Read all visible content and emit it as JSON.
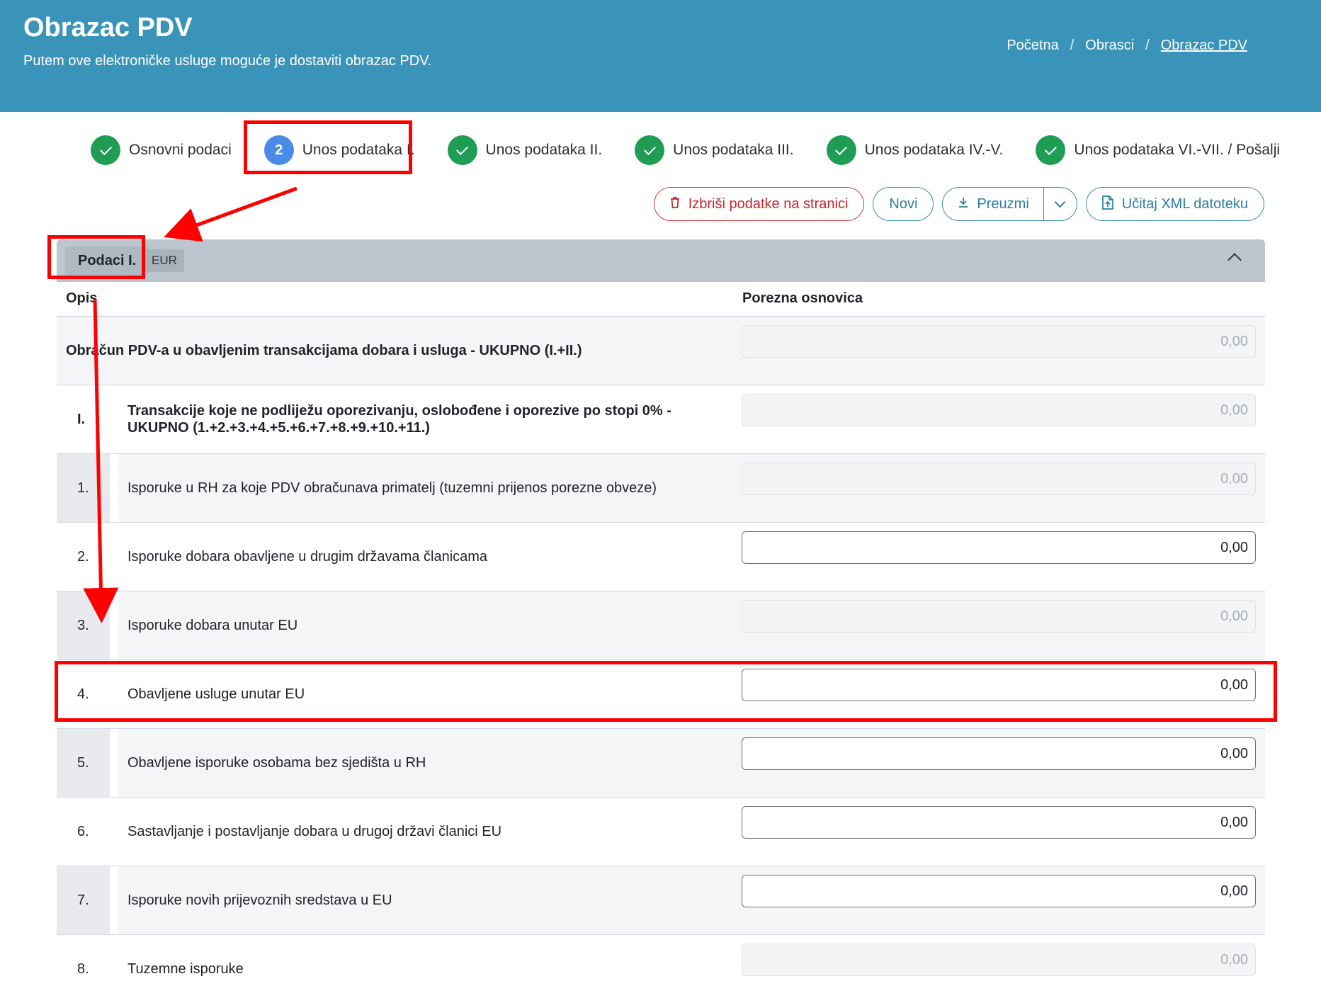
{
  "header": {
    "title": "Obrazac PDV",
    "subtitle": "Putem ove elektroničke usluge moguće je dostaviti obrazac PDV.",
    "breadcrumb": [
      "Početna",
      "Obrasci",
      "Obrazac PDV"
    ],
    "separator": "/"
  },
  "steps": [
    {
      "label": "Osnovni podaci",
      "state": "done"
    },
    {
      "label": "Unos podataka I.",
      "state": "active",
      "number": "2"
    },
    {
      "label": "Unos podataka II.",
      "state": "done"
    },
    {
      "label": "Unos podataka III.",
      "state": "done"
    },
    {
      "label": "Unos podataka IV.-V.",
      "state": "done"
    },
    {
      "label": "Unos podataka VI.-VII. / Pošalji",
      "state": "done"
    }
  ],
  "toolbar": {
    "delete_label": "Izbriši podatke na stranici",
    "new_label": "Novi",
    "download_label": "Preuzmi",
    "upload_label": "Učitaj XML datoteku"
  },
  "section": {
    "title": "Podaci I.",
    "currency": "EUR"
  },
  "table": {
    "col_desc": "Opis",
    "col_base": "Porezna osnovica",
    "rows": [
      {
        "num": "",
        "desc": "Obračun PDV-a u obavljenim transakcijama dobara i usluga - UKUPNO (I.+II.)",
        "value": "0,00",
        "editable": false
      },
      {
        "num": "I.",
        "desc": "Transakcije koje ne podliježu oporezivanju, oslobođene i oporezive po stopi 0% - UKUPNO (1.+2.+3.+4.+5.+6.+7.+8.+9.+10.+11.)",
        "value": "0,00",
        "editable": false
      },
      {
        "num": "1.",
        "desc": "Isporuke u RH za koje PDV obračunava primatelj (tuzemni prijenos porezne obveze)",
        "value": "0,00",
        "editable": false
      },
      {
        "num": "2.",
        "desc": "Isporuke dobara obavljene u drugim državama članicama",
        "value": "0,00",
        "editable": true
      },
      {
        "num": "3.",
        "desc": "Isporuke dobara unutar EU",
        "value": "0,00",
        "editable": false
      },
      {
        "num": "4.",
        "desc": "Obavljene usluge unutar EU",
        "value": "0,00",
        "editable": true
      },
      {
        "num": "5.",
        "desc": "Obavljene isporuke osobama bez sjedišta u RH",
        "value": "0,00",
        "editable": true
      },
      {
        "num": "6.",
        "desc": "Sastavljanje i postavljanje dobara u drugoj državi članici EU",
        "value": "0,00",
        "editable": true
      },
      {
        "num": "7.",
        "desc": "Isporuke novih prijevoznih sredstava u EU",
        "value": "0,00",
        "editable": true
      },
      {
        "num": "8.",
        "desc": "Tuzemne isporuke",
        "value": "0,00",
        "editable": false
      }
    ]
  },
  "colors": {
    "header_bg": "#3a93b8",
    "step_done": "#1f9d55",
    "step_active": "#4a8be8",
    "annotation": "#ff0000"
  }
}
